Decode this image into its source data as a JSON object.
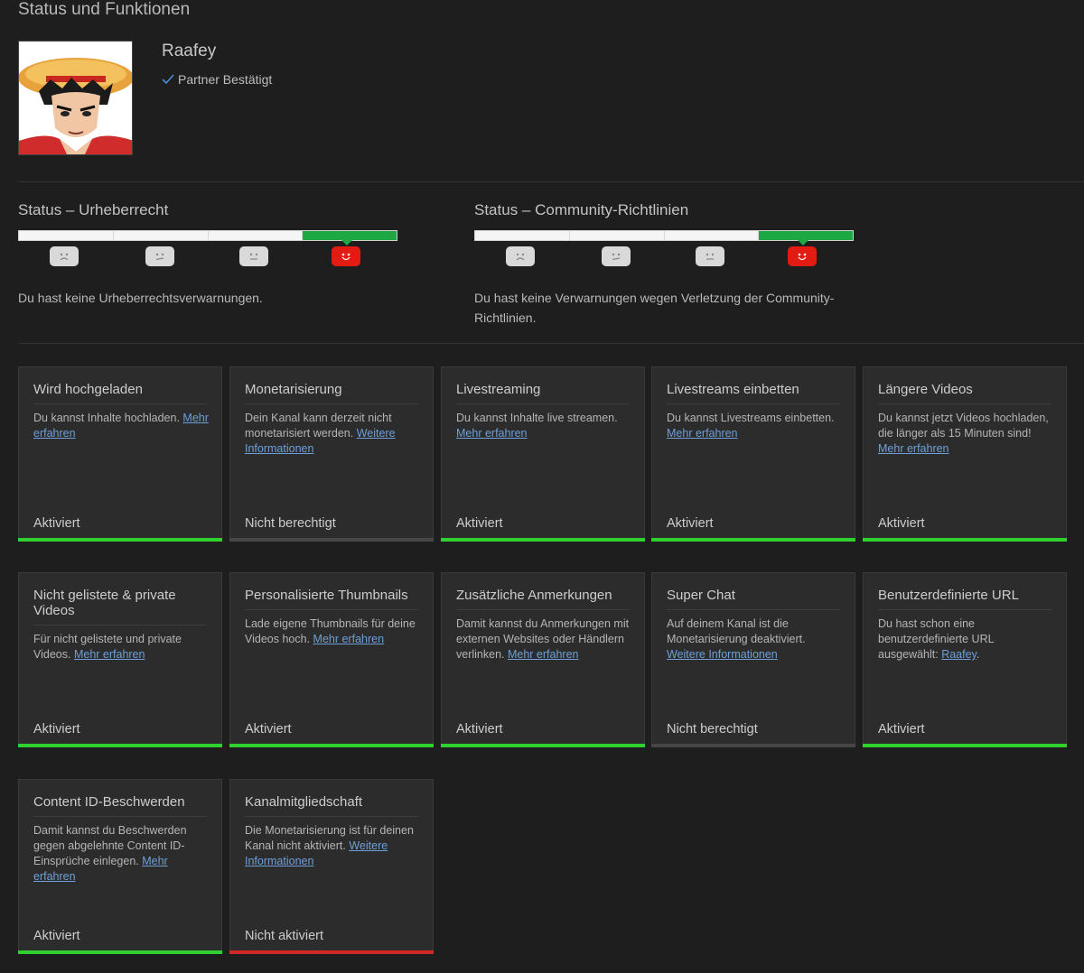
{
  "page_title": "Status und Funktionen",
  "channel": {
    "name": "Raafey",
    "partner_label": "Partner Bestätigt"
  },
  "status": [
    {
      "title": "Status – Urheberrecht",
      "text": "Du hast keine Urheberrechtsverwarnungen.",
      "active_level": 4
    },
    {
      "title": "Status – Community-Richtlinien",
      "text": "Du hast keine Verwarnungen wegen Verletzung der Community-Richtlinien.",
      "active_level": 4
    }
  ],
  "colors": {
    "active_green": "#2ed12e",
    "inactive_red": "#d42727",
    "neutral_gray": "#464646",
    "link_blue": "#6f9fd8",
    "status_red": "#e21b13",
    "meter_green": "#1da844"
  },
  "cards": [
    {
      "title": "Wird hochgeladen",
      "desc": "Du kannst Inhalte hochladen.",
      "link": "Mehr erfahren",
      "tail": "",
      "state": "Aktiviert",
      "bar": "green"
    },
    {
      "title": "Monetarisierung",
      "desc": "Dein Kanal kann derzeit nicht monetarisiert werden.",
      "link": "Weitere Informationen",
      "tail": "",
      "state": "Nicht berechtigt",
      "bar": "gray"
    },
    {
      "title": "Livestreaming",
      "desc": "Du kannst Inhalte live streamen.",
      "link": "Mehr erfahren",
      "tail": "",
      "state": "Aktiviert",
      "bar": "green"
    },
    {
      "title": "Livestreams einbetten",
      "desc": "Du kannst Livestreams einbetten.",
      "link": "Mehr erfahren",
      "tail": "",
      "state": "Aktiviert",
      "bar": "green"
    },
    {
      "title": "Längere Videos",
      "desc": "Du kannst jetzt Videos hochladen, die länger als 15 Minuten sind!",
      "link": "Mehr erfahren",
      "tail": "",
      "state": "Aktiviert",
      "bar": "green"
    },
    {
      "title": "Nicht gelistete & private Videos",
      "desc": "Für nicht gelistete und private Videos.",
      "link": "Mehr erfahren",
      "tail": "",
      "state": "Aktiviert",
      "bar": "green"
    },
    {
      "title": "Personalisierte Thumbnails",
      "desc": "Lade eigene Thumbnails für deine Videos hoch.",
      "link": "Mehr erfahren",
      "tail": "",
      "state": "Aktiviert",
      "bar": "green"
    },
    {
      "title": "Zusätzliche Anmerkungen",
      "desc": "Damit kannst du Anmerkungen mit externen Websites oder Händlern verlinken.",
      "link": "Mehr erfahren",
      "tail": "",
      "state": "Aktiviert",
      "bar": "green"
    },
    {
      "title": "Super Chat",
      "desc": "Auf deinem Kanal ist die Monetarisierung deaktiviert.",
      "link": "Weitere Informationen",
      "tail": "",
      "state": "Nicht berechtigt",
      "bar": "gray"
    },
    {
      "title": "Benutzerdefinierte URL",
      "desc": "Du hast schon eine benutzerdefinierte URL ausgewählt:",
      "link": "Raafey",
      "tail": ".",
      "state": "Aktiviert",
      "bar": "green"
    },
    {
      "title": "Content ID-Beschwerden",
      "desc": "Damit kannst du Beschwerden gegen abgelehnte Content ID-Einsprüche einlegen.",
      "link": "Mehr erfahren",
      "tail": "",
      "state": "Aktiviert",
      "bar": "green"
    },
    {
      "title": "Kanalmitgliedschaft",
      "desc": "Die Monetarisierung ist für deinen Kanal nicht aktiviert.",
      "link": "Weitere Informationen",
      "tail": "",
      "state": "Nicht aktiviert",
      "bar": "red"
    }
  ]
}
